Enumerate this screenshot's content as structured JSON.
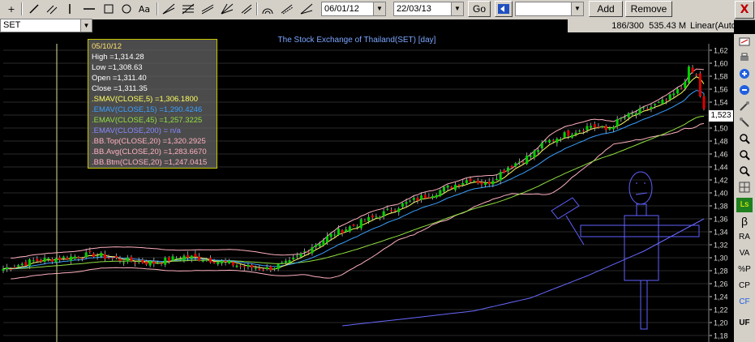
{
  "toolbar": {
    "date_from": "06/01/12",
    "date_to": "22/03/13",
    "go_label": "Go",
    "add_label": "Add",
    "remove_label": "Remove",
    "text_tool_label": "Aa",
    "close_label": "X"
  },
  "symbol": "SET",
  "status": {
    "bars": "186/300",
    "value": "535.43 M",
    "scale": "Linear(Auto"
  },
  "chart_title": "The Stock Exchange of Thailand(SET) [day]",
  "sidebar": {
    "ls": "Ls",
    "beta": "β",
    "ra": "RA",
    "va": "VA",
    "pct_p": "%P",
    "cp": "CP",
    "cf": "CF",
    "uf": "UF"
  },
  "infobox": {
    "date": "05/10/12",
    "high": "High  =1,314.28",
    "low": "Low  =1,308.63",
    "open": "Open  =1,311.40",
    "close": "Close  =1,311.35",
    "sma5": ".SMAV(CLOSE,5)   =1,306.1800",
    "ema15": ".EMAV(CLOSE,15)   =1,290.4246",
    "ema45": ".EMAV(CLOSE,45)   =1,257.3225",
    "ema200": ".EMAV(CLOSE,200)   = n/a",
    "bbtop": ".BB.Top(CLOSE,20)   =1,320.2925",
    "bbavg": ".BB.Avg(CLOSE,20)   =1,283.6670",
    "bbbtm": ".BB.Btm(CLOSE,20)   =1,247.0415"
  },
  "last_price": "1,523",
  "colors": {
    "up": "#00d000",
    "down": "#e00000",
    "sma5": "#ffff60",
    "ema15": "#3aa0ff",
    "ema45": "#90e040",
    "ema200": "#6868ff",
    "bb": "#ffb0c0",
    "drawing": "#6060ff",
    "info_text": "#ffffff"
  },
  "chart_data": {
    "type": "candlestick",
    "title": "The Stock Exchange of Thailand(SET) [day]",
    "y_ticks": [
      1180,
      1200,
      1220,
      1240,
      1260,
      1280,
      1300,
      1320,
      1340,
      1360,
      1380,
      1400,
      1420,
      1440,
      1460,
      1480,
      1500,
      1520,
      1540,
      1560,
      1580,
      1600,
      1620
    ],
    "y_tick_labels": [
      "1,18",
      "1,20",
      "1,22",
      "1,24",
      "1,26",
      "1,28",
      "1,30",
      "1,32",
      "1,34",
      "1,36",
      "1,38",
      "1,40",
      "1,42",
      "1,44",
      "1,46",
      "1,48",
      "1,50",
      "1,52",
      "1,54",
      "1,56",
      "1,58",
      "1,60",
      "1,62"
    ],
    "ylim": [
      1170,
      1630
    ],
    "grid": true,
    "close_anchors": [
      [
        0,
        1283
      ],
      [
        8,
        1295
      ],
      [
        16,
        1300
      ],
      [
        24,
        1305
      ],
      [
        32,
        1296
      ],
      [
        40,
        1292
      ],
      [
        48,
        1302
      ],
      [
        56,
        1296
      ],
      [
        64,
        1286
      ],
      [
        70,
        1283
      ],
      [
        76,
        1292
      ],
      [
        82,
        1318
      ],
      [
        88,
        1338
      ],
      [
        94,
        1352
      ],
      [
        100,
        1366
      ],
      [
        106,
        1382
      ],
      [
        112,
        1395
      ],
      [
        118,
        1408
      ],
      [
        124,
        1422
      ],
      [
        128,
        1413
      ],
      [
        134,
        1440
      ],
      [
        140,
        1458
      ],
      [
        144,
        1478
      ],
      [
        150,
        1492
      ],
      [
        156,
        1504
      ],
      [
        160,
        1497
      ],
      [
        164,
        1514
      ],
      [
        170,
        1528
      ],
      [
        176,
        1542
      ],
      [
        180,
        1562
      ],
      [
        182,
        1590
      ],
      [
        184,
        1580
      ],
      [
        185,
        1550
      ],
      [
        186,
        1527
      ]
    ],
    "series": [
      {
        "name": ".SMAV(CLOSE,5)",
        "values_last": 1306.18
      },
      {
        "name": ".EMAV(CLOSE,15)",
        "values_last": 1290.4246
      },
      {
        "name": ".EMAV(CLOSE,45)",
        "values_last": 1257.3225
      },
      {
        "name": ".EMAV(CLOSE,200)",
        "values_last": null
      },
      {
        "name": ".BB.Top(CLOSE,20)",
        "values_last": 1320.2925
      },
      {
        "name": ".BB.Avg(CLOSE,20)",
        "values_last": 1283.667
      },
      {
        "name": ".BB.Btm(CLOSE,20)",
        "values_last": 1247.0415
      }
    ],
    "ema200_anchors": [
      [
        90,
        1195
      ],
      [
        110,
        1208
      ],
      [
        125,
        1218
      ],
      [
        140,
        1238
      ],
      [
        155,
        1272
      ],
      [
        170,
        1310
      ],
      [
        186,
        1360
      ]
    ]
  }
}
